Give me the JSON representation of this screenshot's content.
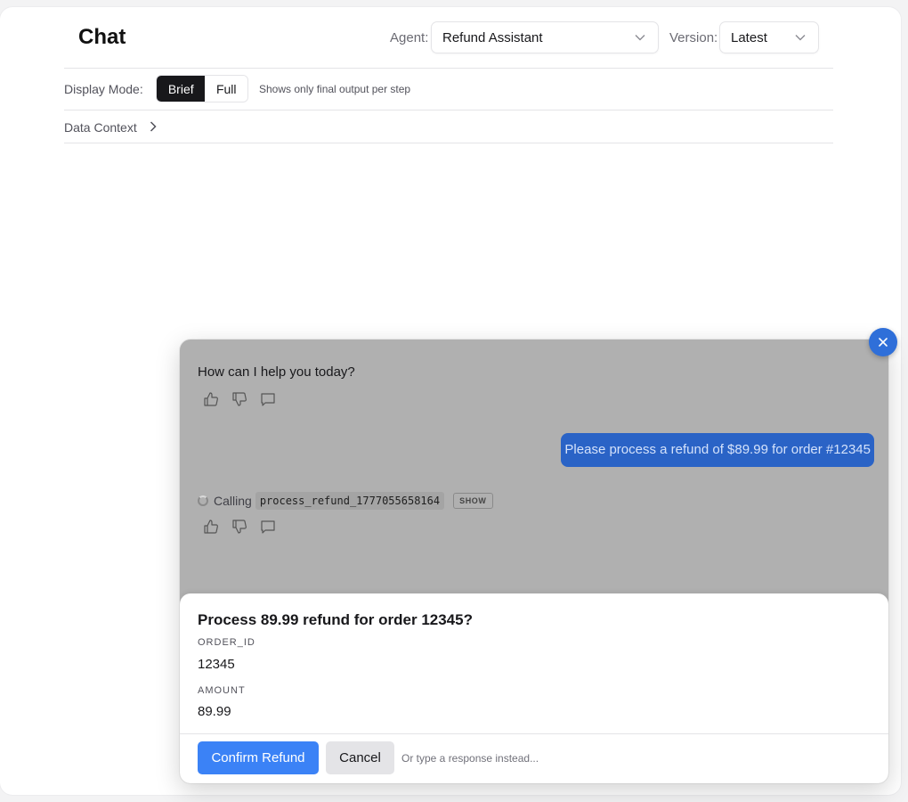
{
  "header": {
    "title": "Chat",
    "agent_label": "Agent:",
    "agent_value": "Refund Assistant",
    "version_label": "Version:",
    "version_value": "Latest"
  },
  "display_mode": {
    "label": "Display Mode:",
    "options": [
      "Brief",
      "Full"
    ],
    "selected": "Brief",
    "hint": "Shows only final output per step"
  },
  "data_context": {
    "label": "Data Context"
  },
  "chat": {
    "assistant_greeting": "How can I help you today?",
    "user_message": "Please process a refund of $89.99 for order #12345",
    "calling_label": "Calling",
    "tool_name": "process_refund_1777055658164",
    "show_label": "SHOW",
    "feedback_icons": [
      "thumbs-up-icon",
      "thumbs-down-icon",
      "comment-icon"
    ]
  },
  "confirmation": {
    "title": "Process 89.99 refund for order 12345?",
    "fields": [
      {
        "label": "ORDER_ID",
        "value": "12345"
      },
      {
        "label": "AMOUNT",
        "value": "89.99"
      }
    ],
    "confirm_label": "Confirm Refund",
    "cancel_label": "Cancel",
    "response_hint": "Or type a response instead..."
  },
  "colors": {
    "primary": "#3b82f6",
    "user_bubble": "#2a63c6",
    "toggle_active": "#18181b",
    "overlay": "#b0b0b0"
  }
}
